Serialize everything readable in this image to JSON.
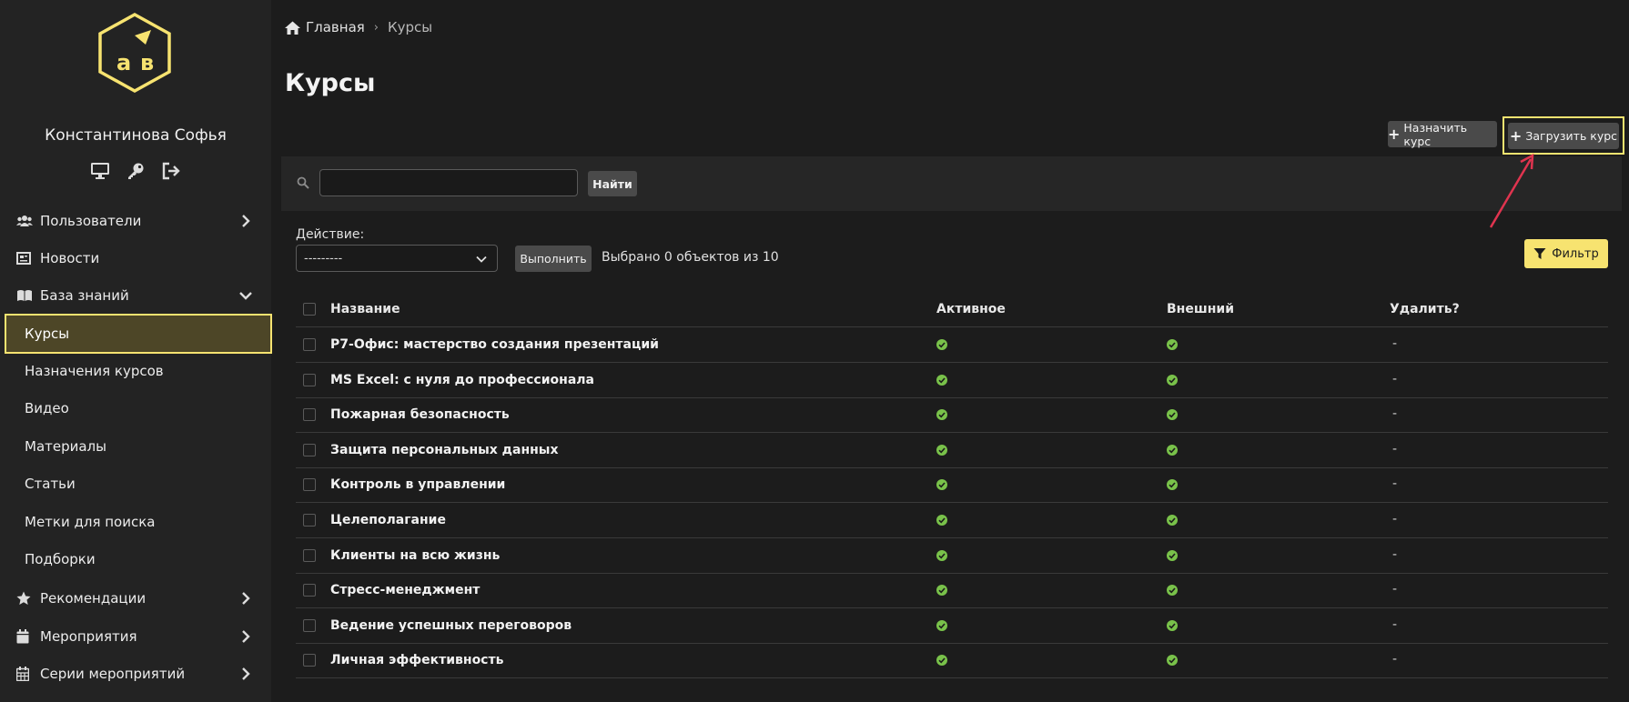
{
  "sidebar": {
    "user_name": "Константинова Софья",
    "user_icons": [
      "monitor-icon",
      "key-icon",
      "logout-icon"
    ],
    "nav": {
      "users": "Пользователи",
      "news": "Новости",
      "knowledge": "База знаний",
      "recommendations": "Рекомендации",
      "events": "Мероприятия",
      "event_series": "Серии мероприятий"
    },
    "sub": {
      "courses": "Курсы",
      "assignments": "Назначения курсов",
      "video": "Видео",
      "materials": "Материалы",
      "articles": "Статьи",
      "tags": "Метки для поиска",
      "collections": "Подборки"
    }
  },
  "breadcrumb": {
    "home": "Главная",
    "separator": "›",
    "current": "Курсы"
  },
  "page": {
    "title": "Курсы"
  },
  "toolbar": {
    "assign_label": "Назначить курс",
    "upload_label": "Загрузить курс"
  },
  "search": {
    "value": "",
    "button": "Найти"
  },
  "actions": {
    "label": "Действие:",
    "selected_option": "---------",
    "run_button": "Выполнить",
    "selection_info": "Выбрано 0 объектов из 10",
    "filter_button": "Фильтр"
  },
  "table": {
    "columns": {
      "name": "Название",
      "active": "Активное",
      "external": "Внешний",
      "delete": "Удалить?"
    },
    "rows": [
      {
        "name": "Р7-Офис: мастерство создания презентаций",
        "delete": "-"
      },
      {
        "name": "MS Excel: с нуля до профессионала",
        "delete": "-"
      },
      {
        "name": "Пожарная безопасность",
        "delete": "-"
      },
      {
        "name": "Защита персональных данных",
        "delete": "-"
      },
      {
        "name": "Контроль в управлении",
        "delete": "-"
      },
      {
        "name": "Целеполагание",
        "delete": "-"
      },
      {
        "name": "Клиенты на всю жизнь",
        "delete": "-"
      },
      {
        "name": "Стресс-менеджмент",
        "delete": "-"
      },
      {
        "name": "Ведение успешных переговоров",
        "delete": "-"
      },
      {
        "name": "Личная эффективность",
        "delete": "-"
      }
    ]
  },
  "colors": {
    "accent": "#f7e370",
    "active_bg": "#4d4627",
    "ok": "#79c24a",
    "annotation_arrow": "#e0344f"
  }
}
